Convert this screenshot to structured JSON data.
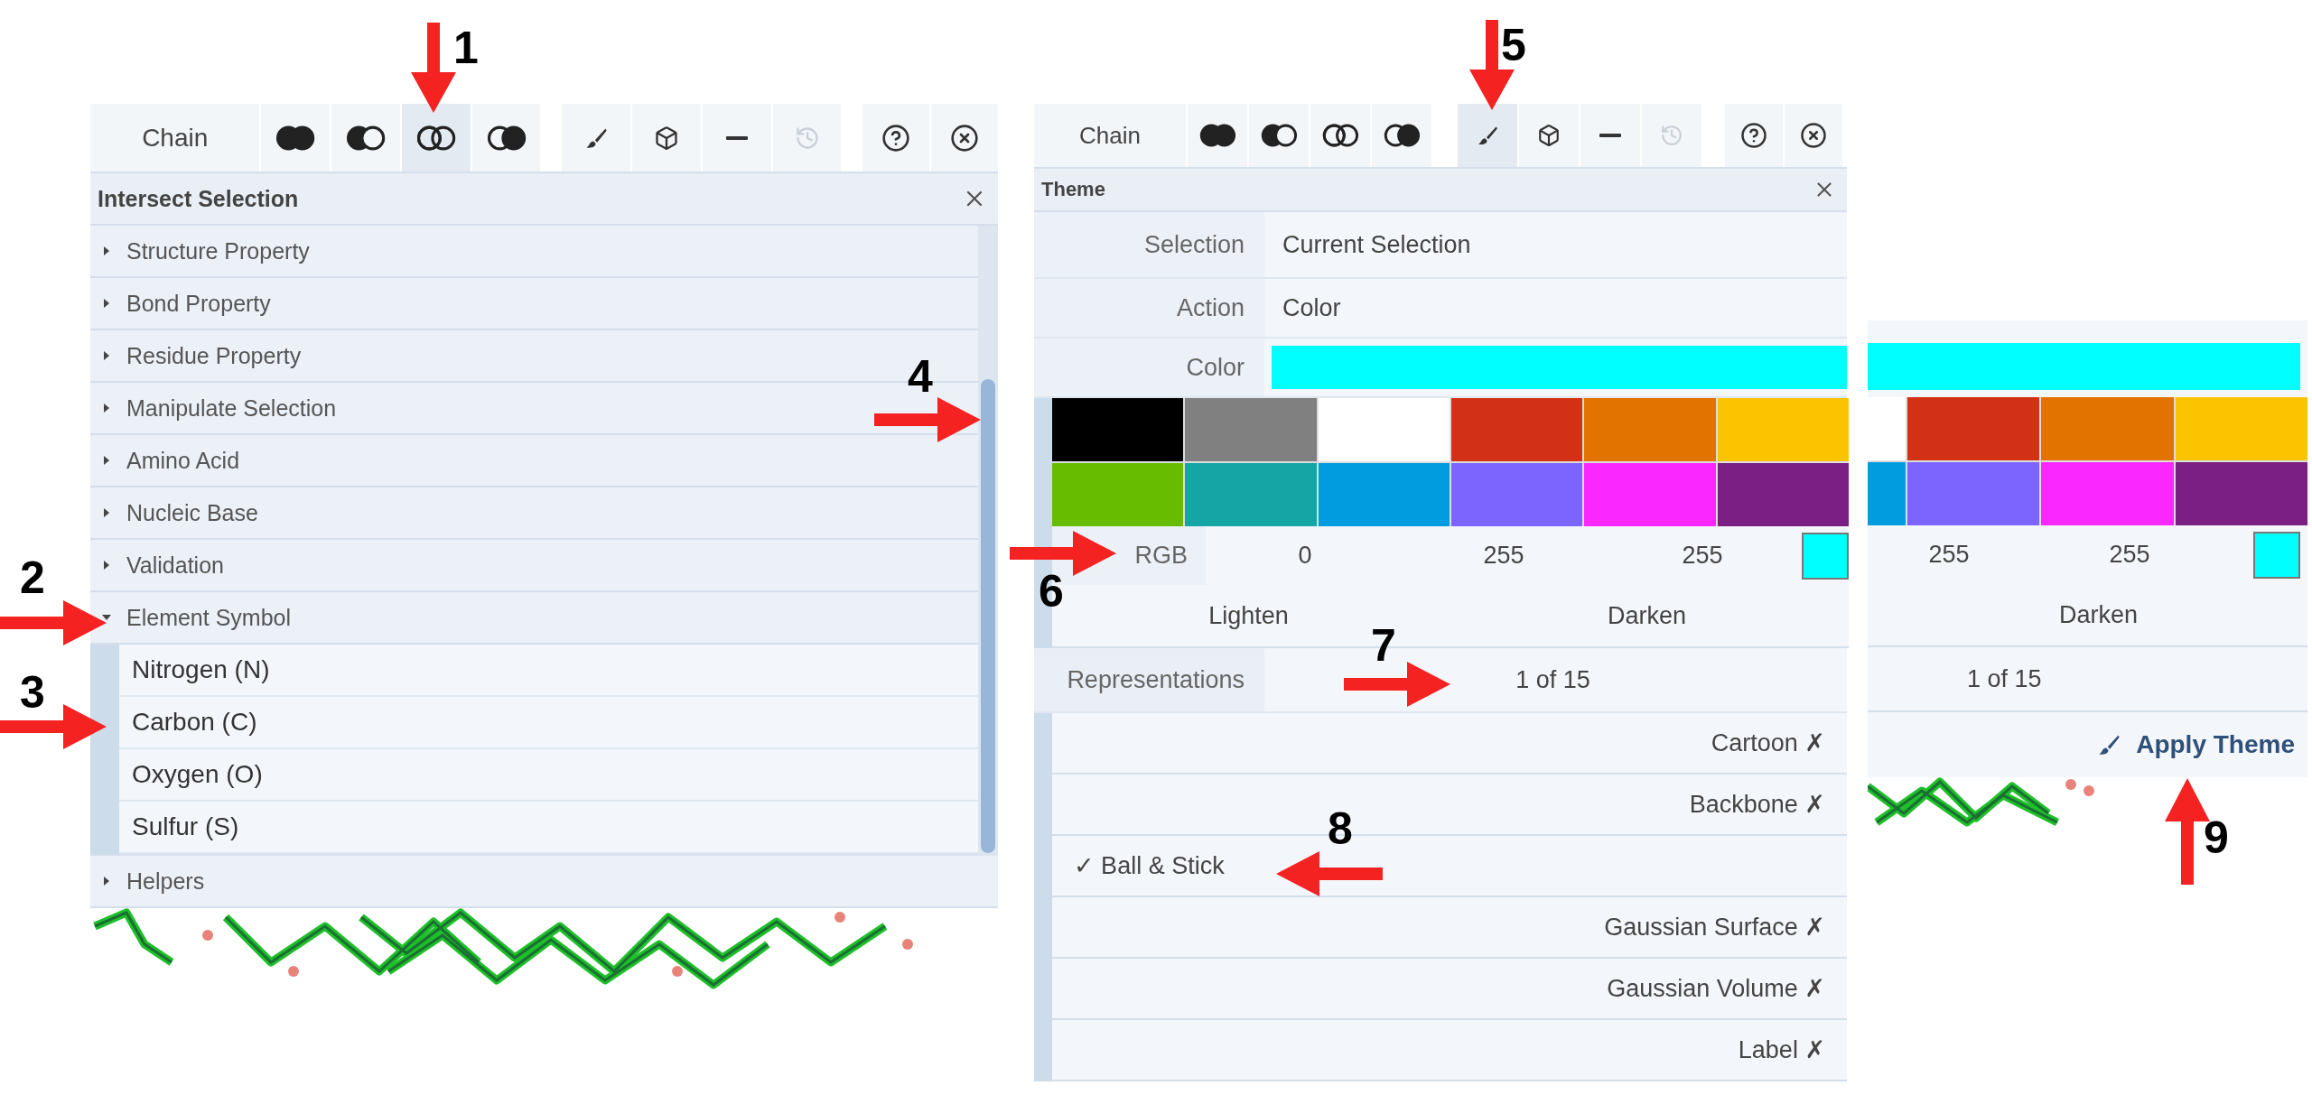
{
  "selection_panel": {
    "toolbar": {
      "label": "Chain",
      "set_buttons": [
        {
          "kind": "union",
          "selected": false
        },
        {
          "kind": "subtract",
          "selected": false
        },
        {
          "kind": "intersect",
          "selected": true
        },
        {
          "kind": "set",
          "selected": false
        }
      ],
      "action_buttons": [
        {
          "kind": "brush",
          "selected": false,
          "disabled": false
        },
        {
          "kind": "cube",
          "selected": false,
          "disabled": false
        },
        {
          "kind": "minus",
          "selected": false,
          "disabled": false
        },
        {
          "kind": "history",
          "selected": false,
          "disabled": true
        }
      ],
      "window_buttons": [
        {
          "kind": "help"
        },
        {
          "kind": "close"
        }
      ]
    },
    "title": "Intersect Selection",
    "categories": [
      {
        "label": "Structure Property",
        "expanded": false
      },
      {
        "label": "Bond Property",
        "expanded": false
      },
      {
        "label": "Residue Property",
        "expanded": false
      },
      {
        "label": "Manipulate Selection",
        "expanded": false
      },
      {
        "label": "Amino Acid",
        "expanded": false
      },
      {
        "label": "Nucleic Base",
        "expanded": false
      },
      {
        "label": "Validation",
        "expanded": false
      },
      {
        "label": "Element Symbol",
        "expanded": true,
        "children": [
          {
            "label": "Nitrogen (N)"
          },
          {
            "label": "Carbon (C)"
          },
          {
            "label": "Oxygen (O)"
          },
          {
            "label": "Sulfur (S)"
          }
        ]
      }
    ],
    "footer_category": {
      "label": "Helpers",
      "expanded": false
    }
  },
  "theme_panel": {
    "toolbar": {
      "label": "Chain",
      "set_buttons": [
        {
          "kind": "union",
          "selected": false
        },
        {
          "kind": "subtract",
          "selected": false
        },
        {
          "kind": "intersect",
          "selected": false
        },
        {
          "kind": "set",
          "selected": false
        }
      ],
      "action_buttons": [
        {
          "kind": "brush",
          "selected": true,
          "disabled": false
        },
        {
          "kind": "cube",
          "selected": false,
          "disabled": false
        },
        {
          "kind": "minus",
          "selected": false,
          "disabled": false
        },
        {
          "kind": "history",
          "selected": false,
          "disabled": true
        }
      ],
      "window_buttons": [
        {
          "kind": "help"
        },
        {
          "kind": "close"
        }
      ]
    },
    "title": "Theme",
    "fields": [
      {
        "label": "Selection",
        "value": "Current Selection"
      },
      {
        "label": "Action",
        "value": "Color"
      }
    ],
    "color_field": {
      "label": "Color",
      "color": "#00ffff"
    },
    "swatches": [
      {
        "color": "#000000"
      },
      {
        "color": "#808080"
      },
      {
        "color": "#ffffff"
      },
      {
        "color": "#d33115"
      },
      {
        "color": "#e27300"
      },
      {
        "color": "#fcc400"
      },
      {
        "color": "#68bc00"
      },
      {
        "color": "#16a5a5"
      },
      {
        "color": "#009ce0"
      },
      {
        "color": "#7b64ff"
      },
      {
        "color": "#fa28ff"
      },
      {
        "color": "#7b1f84"
      }
    ],
    "rgb": {
      "label": "RGB",
      "values": [
        "0",
        "255",
        "255"
      ],
      "color": "#00ffff"
    },
    "adjust_buttons": [
      "Lighten",
      "Darken"
    ],
    "representations": {
      "label": "Representations",
      "count": "1 of 15",
      "items": [
        {
          "label": "Cartoon",
          "checked": false,
          "mark": "✗"
        },
        {
          "label": "Backbone",
          "checked": false,
          "mark": "✗"
        },
        {
          "label": "Ball & Stick",
          "checked": true,
          "mark": "✓"
        },
        {
          "label": "Gaussian Surface",
          "checked": false,
          "mark": "✗"
        },
        {
          "label": "Gaussian Volume",
          "checked": false,
          "mark": "✗"
        },
        {
          "label": "Label",
          "checked": false,
          "mark": "✗"
        }
      ]
    }
  },
  "theme_panel_detail": {
    "color": "#00ffff",
    "swatches": [
      {
        "color": "#ffffff"
      },
      {
        "color": "#d33115"
      },
      {
        "color": "#e27300"
      },
      {
        "color": "#fcc400"
      },
      {
        "color": "#009ce0"
      },
      {
        "color": "#7b64ff"
      },
      {
        "color": "#fa28ff"
      },
      {
        "color": "#7b1f84"
      }
    ],
    "rgb": {
      "values": [
        "255",
        "255"
      ],
      "color": "#00ffff"
    },
    "adjust_buttons": [
      "Darken"
    ],
    "count": "1 of 15",
    "apply_button": "Apply Theme"
  },
  "annotations": [
    {
      "label": "1",
      "kind": "down"
    },
    {
      "label": "2",
      "kind": "right"
    },
    {
      "label": "3",
      "kind": "right"
    },
    {
      "label": "4",
      "kind": "right"
    },
    {
      "label": "5",
      "kind": "down"
    },
    {
      "label": "6",
      "kind": "right"
    },
    {
      "label": "7",
      "kind": "right"
    },
    {
      "label": "8",
      "kind": "left"
    },
    {
      "label": "9",
      "kind": "up"
    }
  ]
}
